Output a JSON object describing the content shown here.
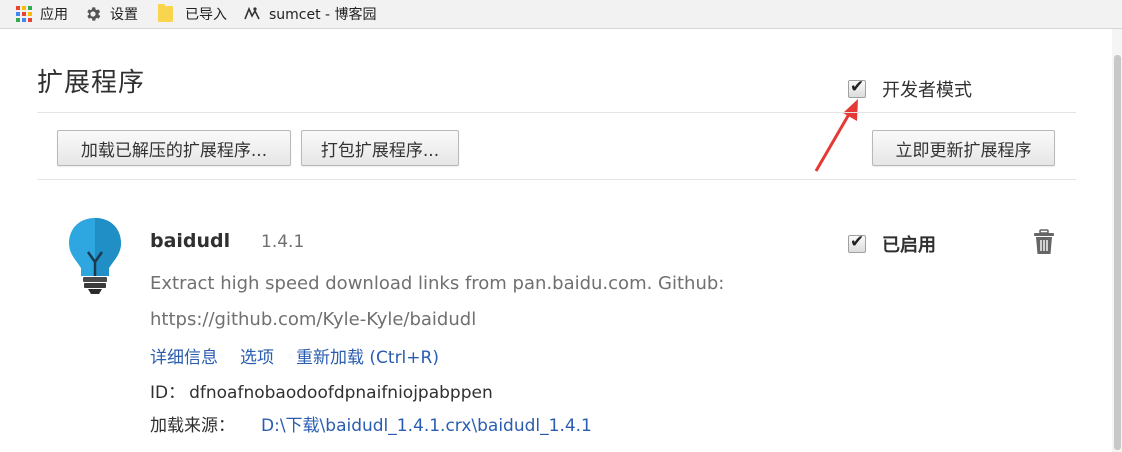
{
  "bookmarks": {
    "items": [
      {
        "label": "应用",
        "icon": "apps-grid-icon"
      },
      {
        "label": "设置",
        "icon": "gear-icon"
      },
      {
        "label": "已导入",
        "icon": "folder-icon"
      },
      {
        "label": "sumcet - 博客园",
        "icon": "cnblogs-icon"
      }
    ]
  },
  "page": {
    "title": "扩展程序",
    "developer_mode": {
      "label": "开发者模式",
      "checked": true
    }
  },
  "toolbar": {
    "load_unpacked": "加载已解压的扩展程序...",
    "pack": "打包扩展程序...",
    "update_now": "立即更新扩展程序"
  },
  "extension": {
    "name": "baidudl",
    "version": "1.4.1",
    "description_line1": "Extract high speed download links from pan.baidu.com. Github:",
    "description_line2": "https://github.com/Kyle-Kyle/baidudl",
    "links": {
      "details": "详细信息",
      "options": "选项",
      "reload": "重新加载 (Ctrl+R)"
    },
    "id_label": "ID：",
    "id_value": "dfnoafnobaodoofdpnaifniojpabppen",
    "load_label": "加载来源：",
    "load_path": "D:\\下载\\baidudl_1.4.1.crx\\baidudl_1.4.1",
    "enabled": {
      "label": "已启用",
      "checked": true
    },
    "icon": "lightbulb-icon"
  },
  "colors": {
    "link": "#2a5db0",
    "annotation_arrow": "#e53935",
    "icon_blue": "#2ea6e0"
  }
}
